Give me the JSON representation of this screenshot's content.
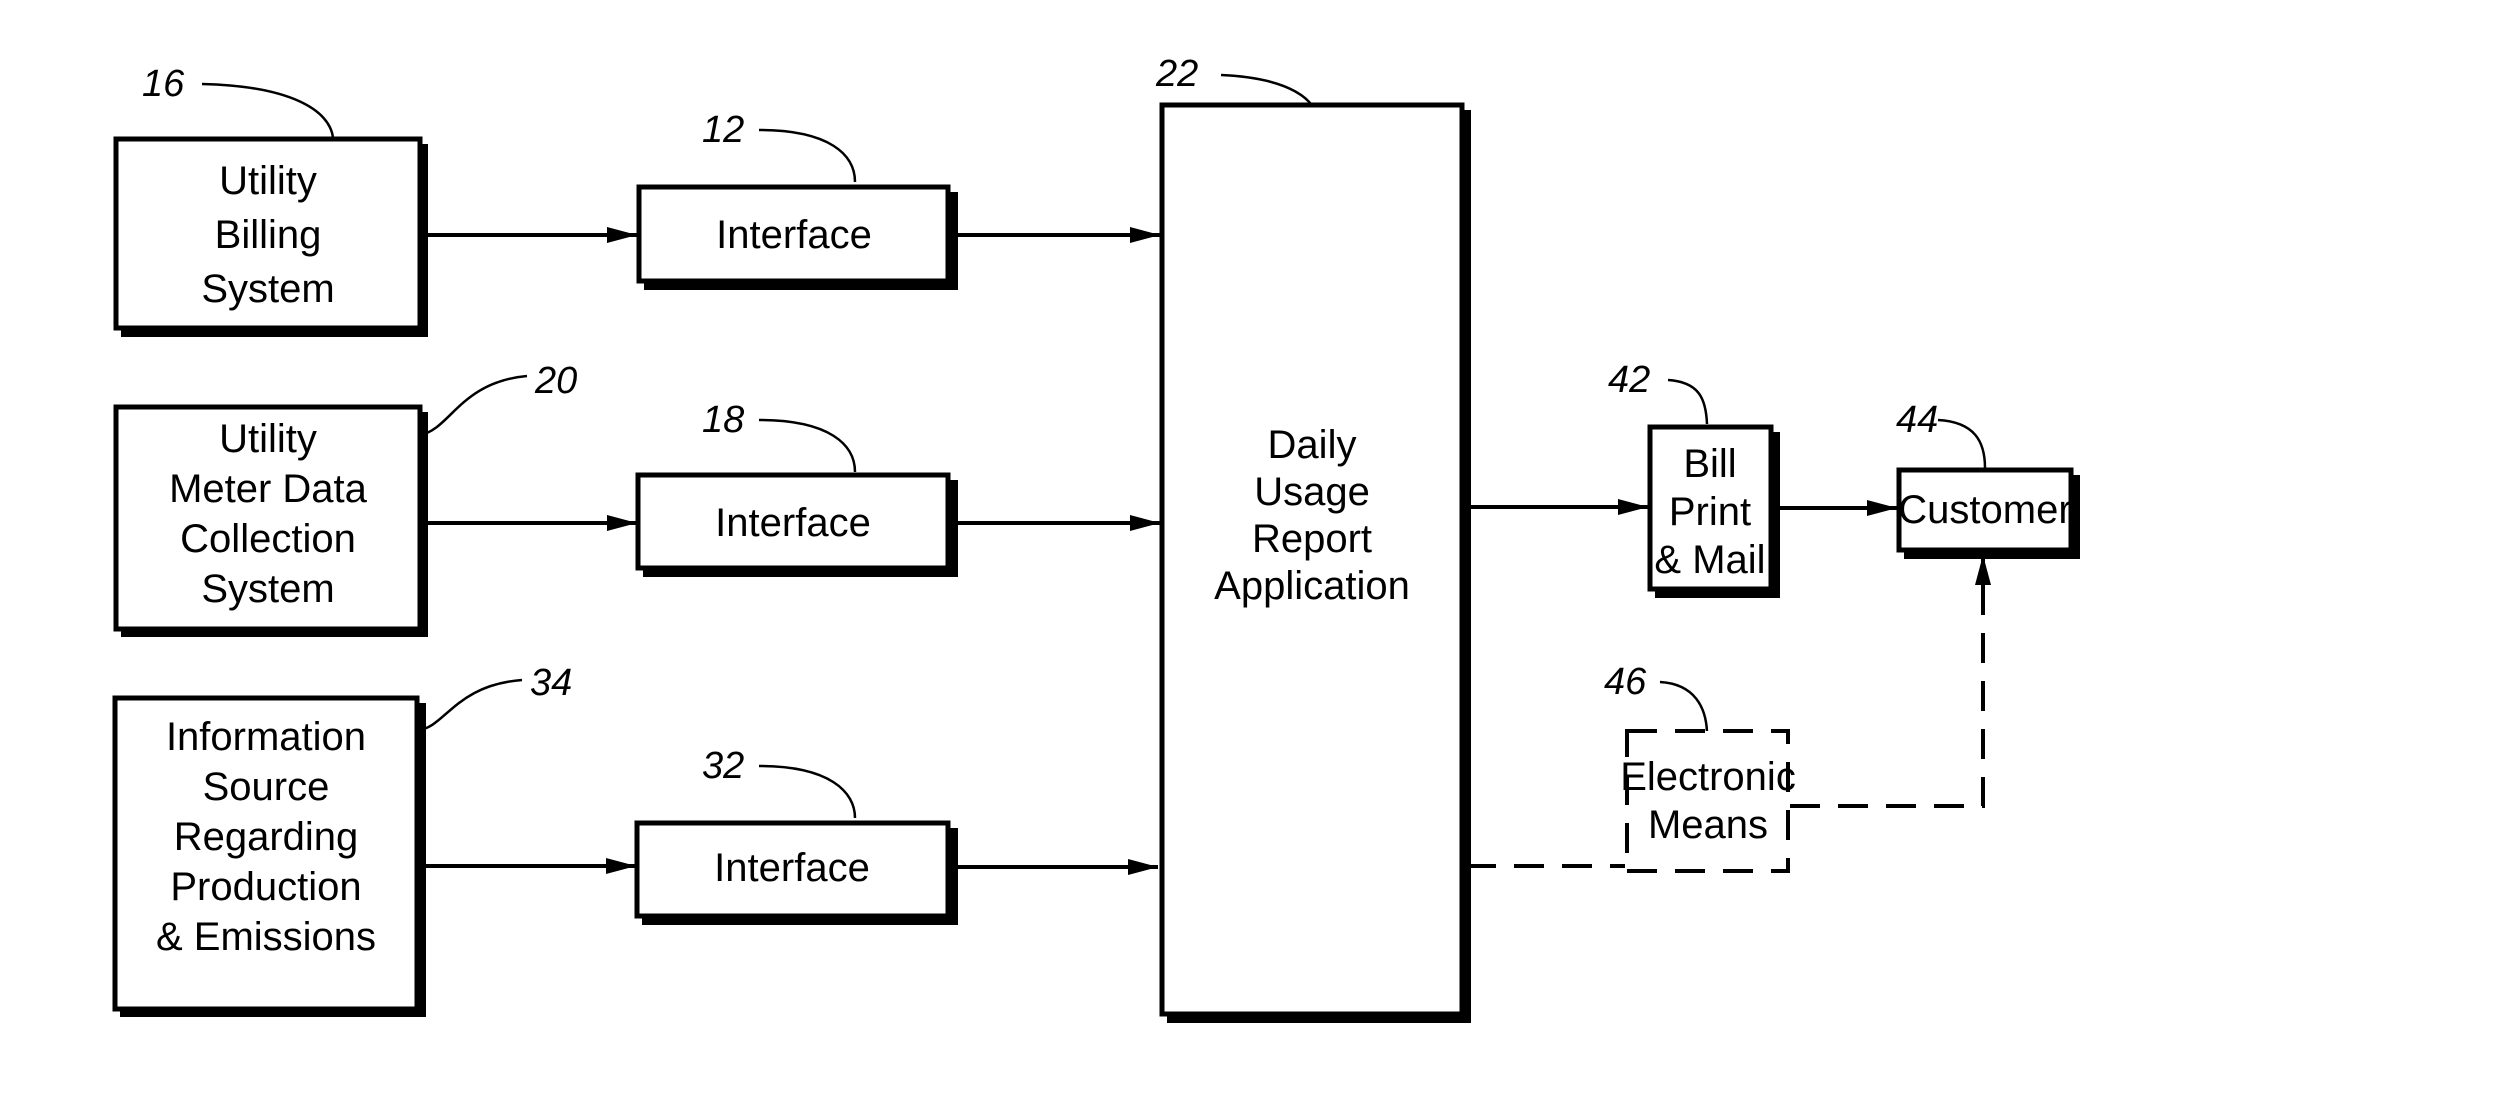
{
  "diagram": {
    "type": "block-diagram",
    "nodes": {
      "utility_billing": {
        "ref": "16",
        "lines": [
          "Utility",
          "Billing",
          "System"
        ]
      },
      "meter_data": {
        "ref": "20",
        "lines": [
          "Utility",
          "Meter Data",
          "Collection",
          "System"
        ]
      },
      "info_source": {
        "ref": "34",
        "lines": [
          "Information",
          "Source",
          "Regarding",
          "Production",
          "& Emissions"
        ]
      },
      "interface_1": {
        "ref": "12",
        "lines": [
          "Interface"
        ]
      },
      "interface_2": {
        "ref": "18",
        "lines": [
          "Interface"
        ]
      },
      "interface_3": {
        "ref": "32",
        "lines": [
          "Interface"
        ]
      },
      "daily_usage": {
        "ref": "22",
        "lines": [
          "Daily",
          "Usage",
          "Report",
          "Application"
        ]
      },
      "bill_print": {
        "ref": "42",
        "lines": [
          "Bill",
          "Print",
          "& Mail"
        ]
      },
      "customer": {
        "ref": "44",
        "lines": [
          "Customer"
        ]
      },
      "electronic_means": {
        "ref": "46",
        "lines": [
          "Electronic",
          "Means"
        ],
        "style": "dashed"
      }
    },
    "edges": [
      {
        "from": "utility_billing",
        "to": "interface_1",
        "style": "solid",
        "arrow": true
      },
      {
        "from": "meter_data",
        "to": "interface_2",
        "style": "solid",
        "arrow": true
      },
      {
        "from": "info_source",
        "to": "interface_3",
        "style": "solid",
        "arrow": true
      },
      {
        "from": "interface_1",
        "to": "daily_usage",
        "style": "solid",
        "arrow": true
      },
      {
        "from": "interface_2",
        "to": "daily_usage",
        "style": "solid",
        "arrow": true
      },
      {
        "from": "interface_3",
        "to": "daily_usage",
        "style": "solid",
        "arrow": true
      },
      {
        "from": "daily_usage",
        "to": "bill_print",
        "style": "solid",
        "arrow": true
      },
      {
        "from": "bill_print",
        "to": "customer",
        "style": "solid",
        "arrow": true
      },
      {
        "from": "daily_usage",
        "to": "electronic_means",
        "style": "dashed",
        "arrow": false
      },
      {
        "from": "electronic_means",
        "to": "customer",
        "style": "dashed",
        "arrow": true
      }
    ]
  }
}
